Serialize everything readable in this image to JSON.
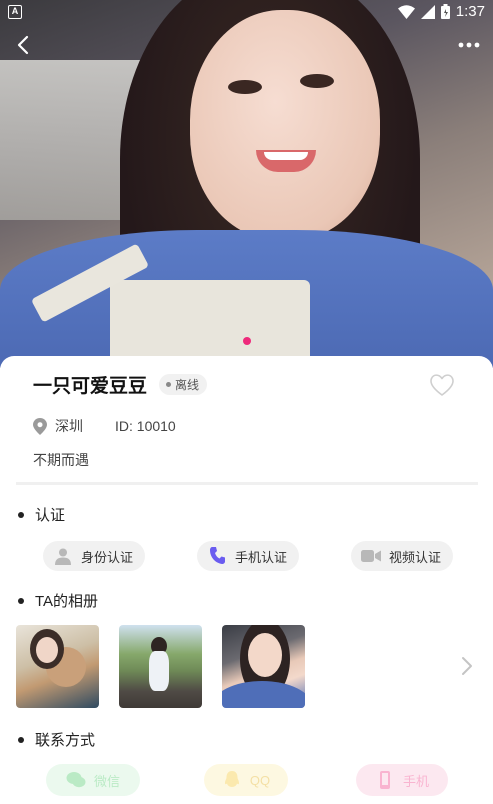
{
  "status_bar": {
    "app_badge": "A",
    "time": "1:37"
  },
  "profile": {
    "name": "一只可爱豆豆",
    "online_status": "离线",
    "city": "深圳",
    "id_text": "ID: 10010",
    "bio": "不期而遇"
  },
  "sections": {
    "verification_title": "认证",
    "album_title": "TA的相册",
    "contact_title": "联系方式"
  },
  "verifications": [
    {
      "label": "身份认证",
      "icon": "person-icon"
    },
    {
      "label": "手机认证",
      "icon": "phone-icon"
    },
    {
      "label": "视频认证",
      "icon": "video-icon"
    }
  ],
  "contacts": [
    {
      "label": "微信",
      "icon": "wechat-icon",
      "color": "#3cc65b"
    },
    {
      "label": "QQ",
      "icon": "qq-icon",
      "color": "#f5c11b"
    },
    {
      "label": "手机",
      "icon": "mobile-icon",
      "color": "#ee2a7b"
    }
  ],
  "carousel": {
    "active_index": 0,
    "total": 1
  },
  "colors": {
    "accent": "#ee2a7b",
    "phone_verified": "#6a5cf0"
  }
}
